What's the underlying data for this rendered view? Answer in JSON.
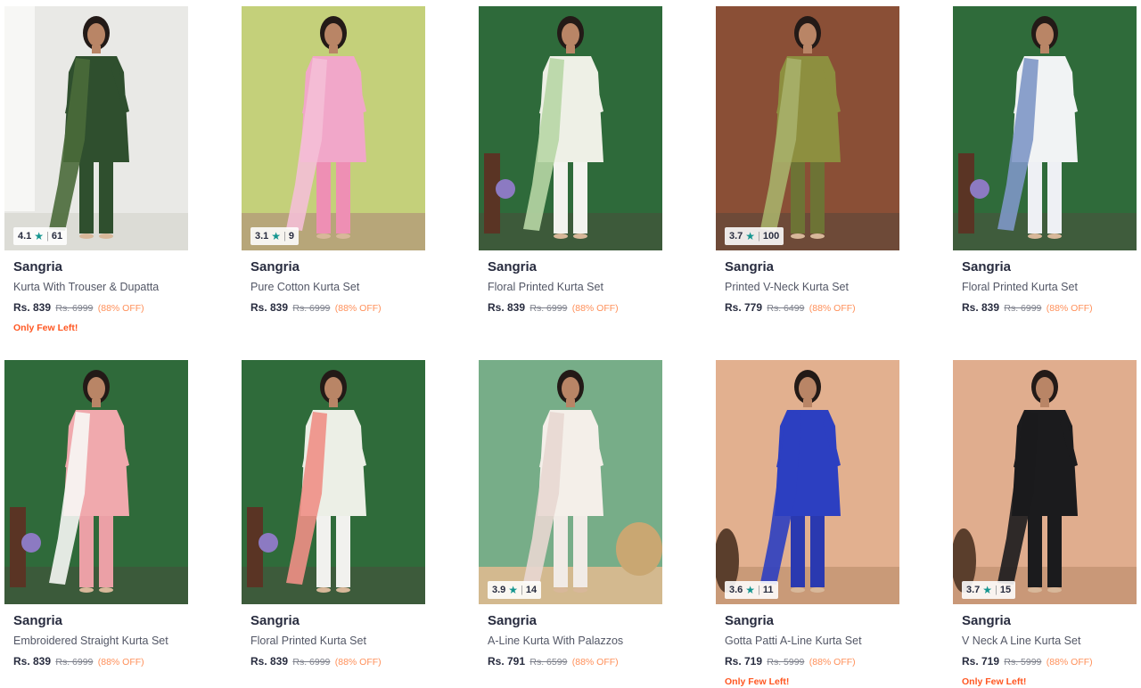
{
  "products": [
    {
      "brand": "Sangria",
      "name": "Kurta With Trouser & Dupatta",
      "price": "Rs. 839",
      "mrp": "Rs. 6999",
      "discount": "(88% OFF)",
      "badge": "Only Few Left!",
      "rating": "4.1",
      "reviews": "61",
      "colors": {
        "bg": "#e9e9e6",
        "floor": "#dcdcd6",
        "outfit": "#2f4f2e",
        "dupatta": "#4a6a3a",
        "pants": "#2f4f2e"
      }
    },
    {
      "brand": "Sangria",
      "name": "Pure Cotton Kurta Set",
      "price": "Rs. 839",
      "mrp": "Rs. 6999",
      "discount": "(88% OFF)",
      "badge": "",
      "rating": "3.1",
      "reviews": "9",
      "colors": {
        "bg": "#c4d07a",
        "floor": "#b7a679",
        "outfit": "#f1a7c9",
        "dupatta": "#f4bfd6",
        "pants": "#ee8fb4"
      }
    },
    {
      "brand": "Sangria",
      "name": "Floral Printed Kurta Set",
      "price": "Rs. 839",
      "mrp": "Rs. 6999",
      "discount": "(88% OFF)",
      "badge": "",
      "rating": "",
      "reviews": "",
      "colors": {
        "bg": "#2e6a3a",
        "floor": "#3d5a3a",
        "outfit": "#eef0e6",
        "dupatta": "#b7d6a5",
        "pants": "#f3f3ef"
      }
    },
    {
      "brand": "Sangria",
      "name": "Printed V-Neck Kurta Set",
      "price": "Rs. 779",
      "mrp": "Rs. 6499",
      "discount": "(88% OFF)",
      "badge": "",
      "rating": "3.7",
      "reviews": "100",
      "colors": {
        "bg": "#8a4f36",
        "floor": "#6e4a38",
        "outfit": "#8d8f3f",
        "dupatta": "#a7b06a",
        "pants": "#6d7335"
      }
    },
    {
      "brand": "Sangria",
      "name": "Floral Printed Kurta Set",
      "price": "Rs. 839",
      "mrp": "Rs. 6999",
      "discount": "(88% OFF)",
      "badge": "",
      "rating": "",
      "reviews": "",
      "colors": {
        "bg": "#2f6b3a",
        "floor": "#3f5c3c",
        "outfit": "#f1f3f4",
        "dupatta": "#7e97c6",
        "pants": "#eef0f4"
      }
    },
    {
      "brand": "Sangria",
      "name": "Embroidered Straight Kurta Set",
      "price": "Rs. 839",
      "mrp": "Rs. 6999",
      "discount": "(88% OFF)",
      "badge": "",
      "rating": "",
      "reviews": "",
      "colors": {
        "bg": "#2f6a3a",
        "floor": "#3b5a3a",
        "outfit": "#f0a9ad",
        "dupatta": "#f7f7f5",
        "pants": "#eba0a6"
      }
    },
    {
      "brand": "Sangria",
      "name": "Floral Printed Kurta Set",
      "price": "Rs. 839",
      "mrp": "Rs. 6999",
      "discount": "(88% OFF)",
      "badge": "",
      "rating": "",
      "reviews": "",
      "colors": {
        "bg": "#2f6b3a",
        "floor": "#3d5b3b",
        "outfit": "#ecefe6",
        "dupatta": "#ef8f86",
        "pants": "#f1f1ee"
      }
    },
    {
      "brand": "Sangria",
      "name": "A-Line Kurta With Palazzos",
      "price": "Rs. 791",
      "mrp": "Rs. 6599",
      "discount": "(88% OFF)",
      "badge": "",
      "rating": "3.9",
      "reviews": "14",
      "colors": {
        "bg": "#77ad88",
        "floor": "#d3b98f",
        "outfit": "#f4efe9",
        "dupatta": "#e8d7d2",
        "pants": "#f1ebe6"
      }
    },
    {
      "brand": "Sangria",
      "name": "Gotta Patti A-Line Kurta Set",
      "price": "Rs. 719",
      "mrp": "Rs. 5999",
      "discount": "(88% OFF)",
      "badge": "Only Few Left!",
      "rating": "3.6",
      "reviews": "11",
      "colors": {
        "bg": "#e2b08f",
        "floor": "#c99a78",
        "outfit": "#2c3fc1",
        "dupatta": "#2c3fc1",
        "pants": "#2a39b0"
      }
    },
    {
      "brand": "Sangria",
      "name": "V Neck A Line Kurta Set",
      "price": "Rs. 719",
      "mrp": "Rs. 5999",
      "discount": "(88% OFF)",
      "badge": "Only Few Left!",
      "rating": "3.7",
      "reviews": "15",
      "colors": {
        "bg": "#e0ad8e",
        "floor": "#c99878",
        "outfit": "#1b1b1d",
        "dupatta": "#1b1b1d",
        "pants": "#1b1b1d"
      }
    }
  ]
}
